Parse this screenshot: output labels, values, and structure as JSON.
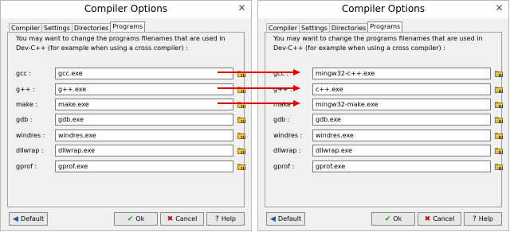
{
  "dialogs": [
    {
      "title": "Compiler Options",
      "tabs": [
        "Compiler",
        "Settings",
        "Directories",
        "Programs"
      ],
      "active_tab": "Programs",
      "description": "You may want to change the programs filenames that are used in Dev-C++ (for example when using a cross compiler) :",
      "rows": [
        {
          "label": "gcc :",
          "value": "gcc.exe"
        },
        {
          "label": "g++ :",
          "value": "g++.exe"
        },
        {
          "label": "make :",
          "value": "make.exe"
        },
        {
          "label": "gdb :",
          "value": "gdb.exe"
        },
        {
          "label": "windres :",
          "value": "windres.exe"
        },
        {
          "label": "dllwrap :",
          "value": "dllwrap.exe"
        },
        {
          "label": "gprof :",
          "value": "gprof.exe"
        }
      ],
      "buttons": {
        "default": "Default",
        "ok": "Ok",
        "cancel": "Cancel",
        "help": "Help"
      }
    },
    {
      "title": "Compiler Options",
      "tabs": [
        "Compiler",
        "Settings",
        "Directories",
        "Programs"
      ],
      "active_tab": "Programs",
      "description": "You may want to change the programs filenames that are used in Dev-C++ (for example when using a cross compiler) :",
      "rows": [
        {
          "label": "gcc :",
          "value": "mingw32-c++.exe"
        },
        {
          "label": "g++ :",
          "value": "c++.exe"
        },
        {
          "label": "make :",
          "value": "mingw32-make.exe"
        },
        {
          "label": "gdb :",
          "value": "gdb.exe"
        },
        {
          "label": "windres :",
          "value": "windres.exe"
        },
        {
          "label": "dllwrap :",
          "value": "dllwrap.exe"
        },
        {
          "label": "gprof :",
          "value": "gprof.exe"
        }
      ],
      "buttons": {
        "default": "Default",
        "ok": "Ok",
        "cancel": "Cancel",
        "help": "Help"
      }
    }
  ],
  "icons": {
    "close": "close-icon",
    "browse": "folder-icon",
    "default": "arrow-left-icon",
    "ok": "checkmark-icon",
    "cancel": "x-icon",
    "help": "question-icon"
  },
  "colors": {
    "arrow": "#e00000",
    "checkmark": "#1a9a1a",
    "cancel": "#cc0000",
    "folder": "#e8c145",
    "default_icon": "#1f4fb0"
  }
}
